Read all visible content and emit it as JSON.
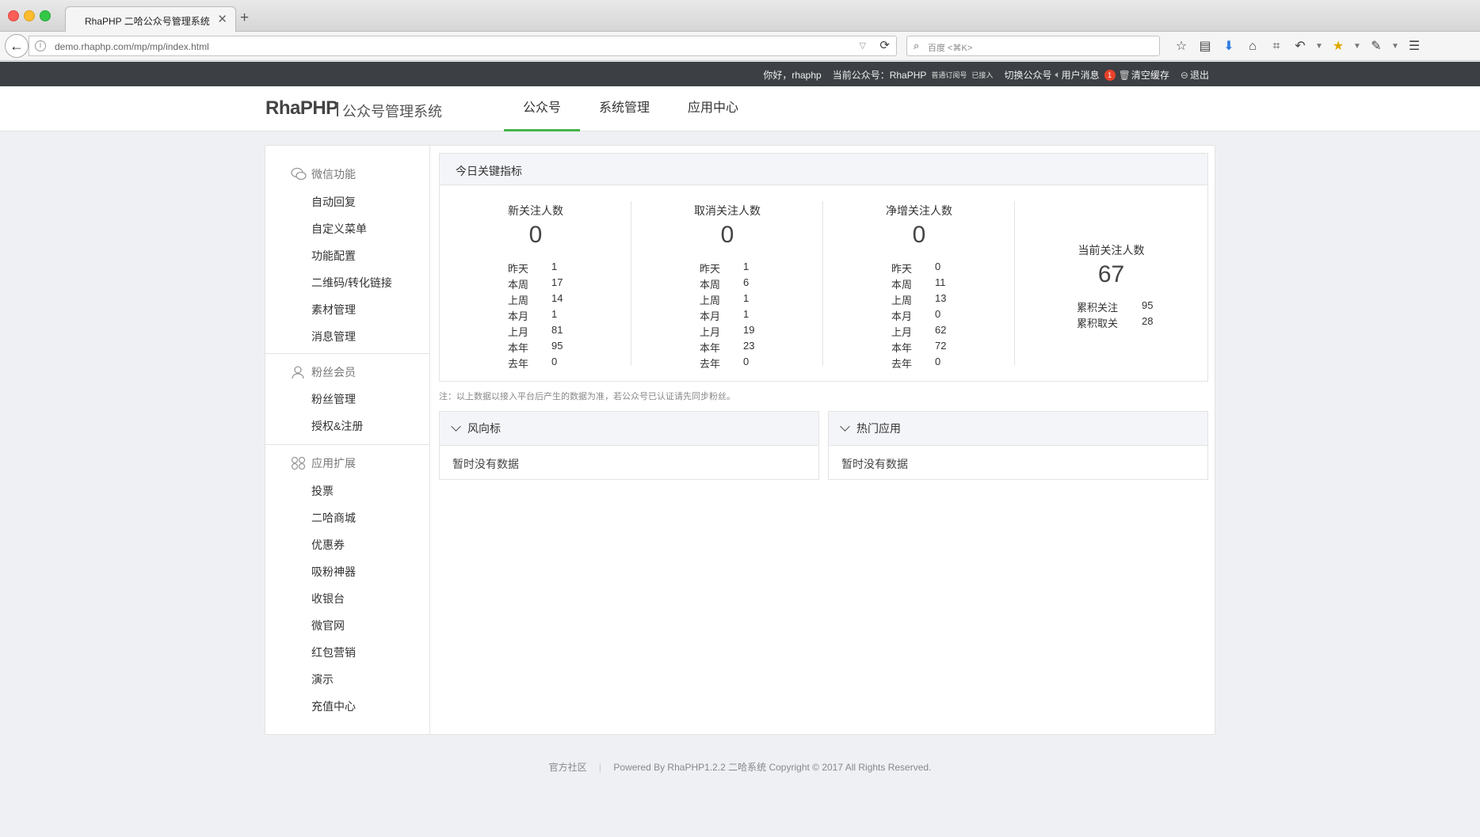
{
  "browser": {
    "tab_title": "RhaPHP 二哈公众号管理系统",
    "url": "demo.rhaphp.com/mp/mp/index.html",
    "search_placeholder": "百度 <⌘K>",
    "toolbar_icons": [
      "star-icon",
      "reading-list-icon",
      "download-icon",
      "home-icon",
      "crop-icon",
      "undo-icon",
      "dropdown-icon",
      "bookmark-extension-icon",
      "dropdown-icon",
      "extension-icon",
      "dropdown-icon",
      "menu-icon"
    ]
  },
  "userbar": {
    "greeting": "你好，rhaphp",
    "current_account_label": "当前公众号：RhaPHP",
    "account_type": "普通订阅号",
    "account_status": "已接入",
    "switch_account": "切换公众号",
    "user_messages": "用户消息",
    "message_count": "1",
    "clear_cache": "清空缓存",
    "logout": "退出"
  },
  "header": {
    "logo": "RhaPHP",
    "logo_sub": "公众号管理系统",
    "nav": [
      "公众号",
      "系统管理",
      "应用中心"
    ],
    "active_nav": "公众号"
  },
  "sidebar": {
    "groups": [
      {
        "title": "微信功能",
        "icon": "wechat-icon",
        "items": [
          "自动回复",
          "自定义菜单",
          "功能配置",
          "二维码/转化链接",
          "素材管理",
          "消息管理"
        ]
      },
      {
        "title": "粉丝会员",
        "icon": "user-icon",
        "items": [
          "粉丝管理",
          "授权&注册"
        ]
      },
      {
        "title": "应用扩展",
        "icon": "apps-icon",
        "items": [
          "投票",
          "二哈商城",
          "优惠券",
          "吸粉神器",
          "收银台",
          "微官网",
          "红包营销",
          "演示",
          "充值中心"
        ]
      }
    ]
  },
  "kpi": {
    "heading": "今日关键指标",
    "columns": [
      {
        "title": "新关注人数",
        "value": "0",
        "rows": [
          [
            "昨天",
            "1"
          ],
          [
            "本周",
            "17"
          ],
          [
            "上周",
            "14"
          ],
          [
            "本月",
            "1"
          ],
          [
            "上月",
            "81"
          ],
          [
            "本年",
            "95"
          ],
          [
            "去年",
            "0"
          ]
        ]
      },
      {
        "title": "取消关注人数",
        "value": "0",
        "rows": [
          [
            "昨天",
            "1"
          ],
          [
            "本周",
            "6"
          ],
          [
            "上周",
            "1"
          ],
          [
            "本月",
            "1"
          ],
          [
            "上月",
            "19"
          ],
          [
            "本年",
            "23"
          ],
          [
            "去年",
            "0"
          ]
        ]
      },
      {
        "title": "净增关注人数",
        "value": "0",
        "rows": [
          [
            "昨天",
            "0"
          ],
          [
            "本周",
            "11"
          ],
          [
            "上周",
            "13"
          ],
          [
            "本月",
            "0"
          ],
          [
            "上月",
            "62"
          ],
          [
            "本年",
            "72"
          ],
          [
            "去年",
            "0"
          ]
        ]
      }
    ],
    "current": {
      "title": "当前关注人数",
      "value": "67",
      "rows": [
        [
          "累积关注",
          "95"
        ],
        [
          "累积取关",
          "28"
        ]
      ]
    }
  },
  "note": "注：以上数据以接入平台后产生的数据为准，若公众号已认证请先同步粉丝。",
  "cards": [
    {
      "title": "风向标",
      "body": "暂时没有数据"
    },
    {
      "title": "热门应用",
      "body": "暂时没有数据"
    }
  ],
  "footer": {
    "community": "官方社区",
    "powered": "Powered By RhaPHP1.2.2 二哈系统 Copyright © 2017 All Rights Reserved."
  }
}
